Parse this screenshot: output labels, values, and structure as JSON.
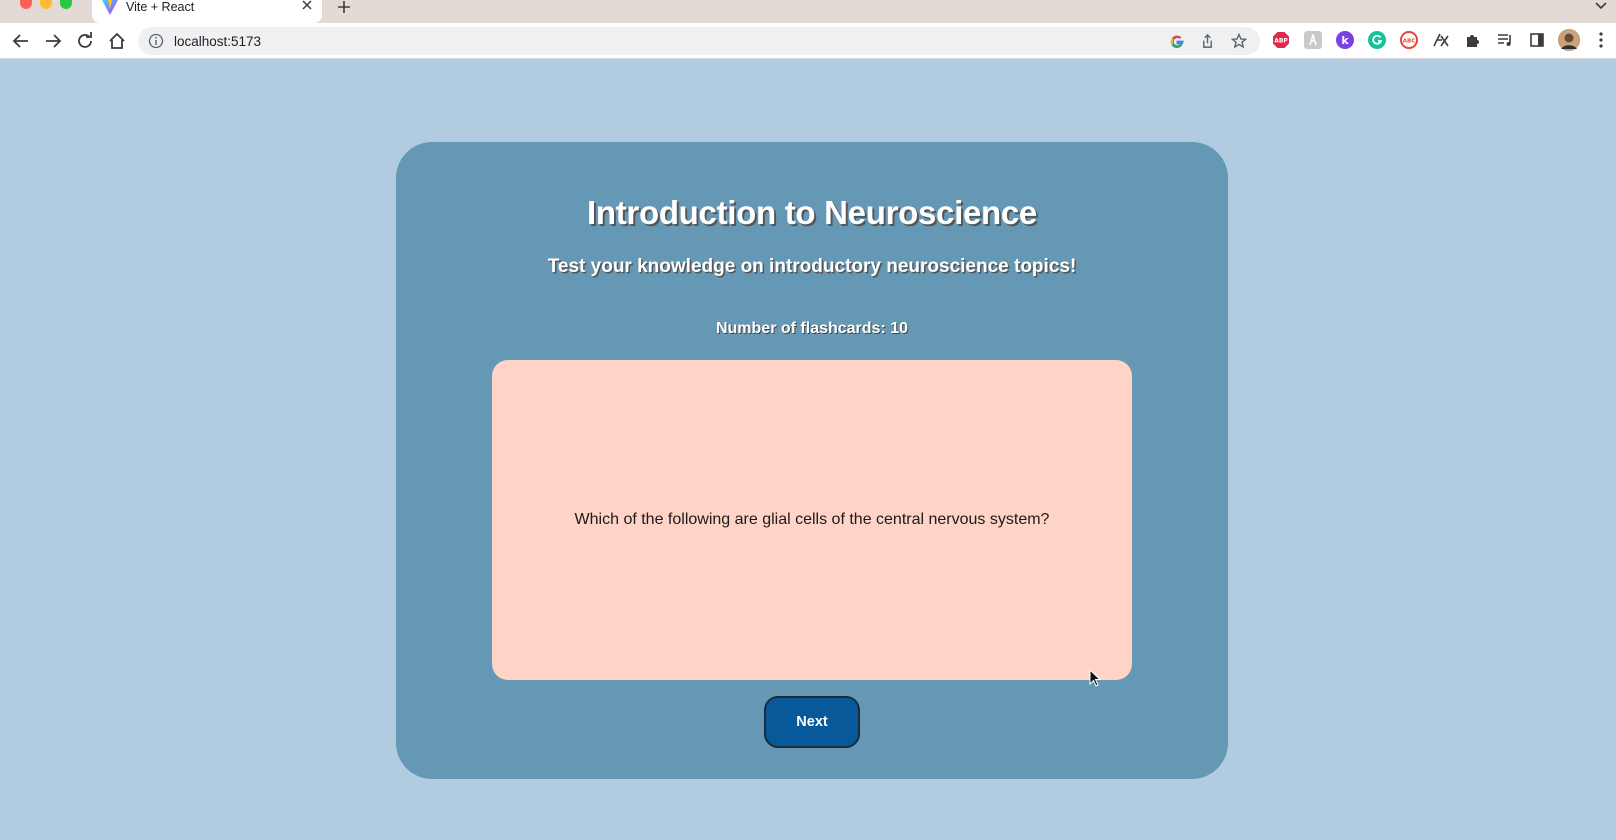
{
  "browser": {
    "tab_title": "Vite + React",
    "url": "localhost:5173",
    "extensions": [
      {
        "name": "adblock-plus-icon",
        "text": "ABP",
        "color": "#e2264d"
      },
      {
        "name": "font-extension-icon",
        "text": "",
        "color": "#c9c9c9"
      },
      {
        "name": "k-extension-icon",
        "text": "k",
        "color": "#7b3fe4"
      },
      {
        "name": "grammarly-icon",
        "text": "",
        "color": "#15c39a"
      },
      {
        "name": "abc-extension-icon",
        "text": "ABC",
        "color": "#e8453c"
      }
    ]
  },
  "app": {
    "title": "Introduction to Neuroscience",
    "subtitle": "Test your knowledge on introductory neuroscience topics!",
    "card_count_label": "Number of flashcards: 10",
    "current_card": {
      "question": "Which of the following are glial cells of the central nervous system?"
    },
    "next_button_label": "Next"
  },
  "colors": {
    "page_background": "#b1cce0",
    "panel_background": "#6598b4",
    "card_background": "#ffd3c6",
    "button_background": "#07599a"
  }
}
